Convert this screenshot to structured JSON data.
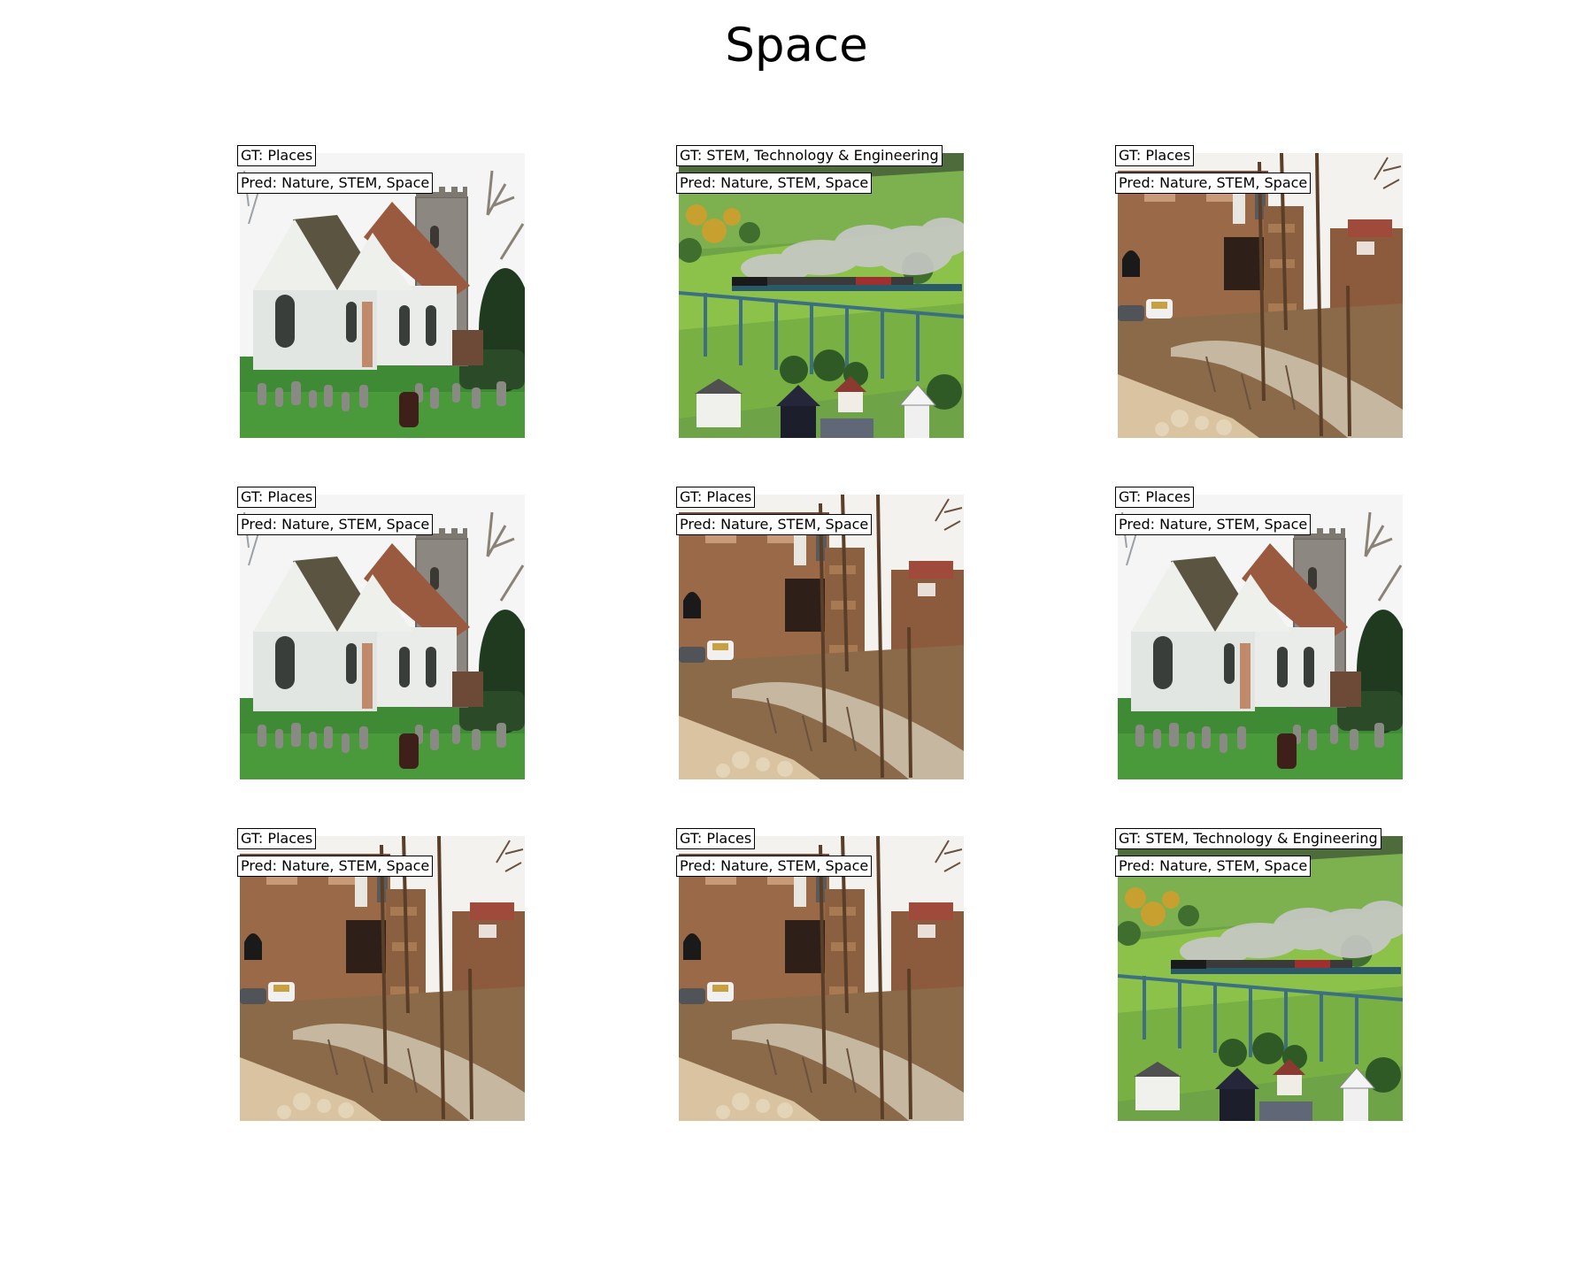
{
  "title": "Space",
  "panels": [
    {
      "gt": "GT: Places",
      "pred": "Pred: Nature, STEM, Space",
      "scene": "church-icon"
    },
    {
      "gt": "GT: STEM, Technology & Engineering",
      "pred": "Pred: Nature, STEM, Space",
      "scene": "train-viaduct-icon"
    },
    {
      "gt": "GT: Places",
      "pred": "Pred: Nature, STEM, Space",
      "scene": "ruins-icon"
    },
    {
      "gt": "GT: Places",
      "pred": "Pred: Nature, STEM, Space",
      "scene": "church-icon"
    },
    {
      "gt": "GT: Places",
      "pred": "Pred: Nature, STEM, Space",
      "scene": "ruins-icon"
    },
    {
      "gt": "GT: Places",
      "pred": "Pred: Nature, STEM, Space",
      "scene": "church-icon"
    },
    {
      "gt": "GT: Places",
      "pred": "Pred: Nature, STEM, Space",
      "scene": "ruins-icon"
    },
    {
      "gt": "GT: Places",
      "pred": "Pred: Nature, STEM, Space",
      "scene": "ruins-icon"
    },
    {
      "gt": "GT: STEM, Technology & Engineering",
      "pred": "Pred: Nature, STEM, Space",
      "scene": "train-viaduct-icon"
    }
  ]
}
